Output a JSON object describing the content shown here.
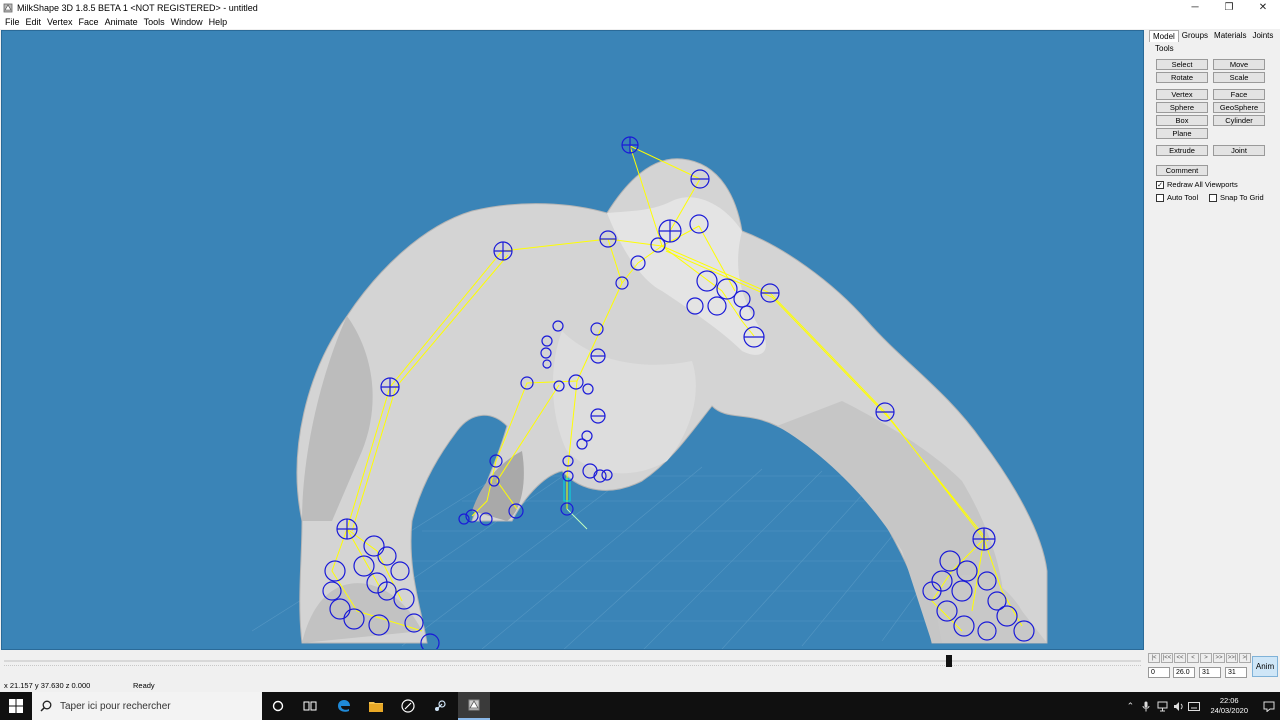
{
  "window": {
    "title": "MilkShape 3D 1.8.5 BETA 1 <NOT REGISTERED> - untitled",
    "controls": {
      "minimize": "─",
      "restore": "❐",
      "close": "✕"
    }
  },
  "menu": [
    "File",
    "Edit",
    "Vertex",
    "Face",
    "Animate",
    "Tools",
    "Window",
    "Help"
  ],
  "panel": {
    "tabs": [
      "Model",
      "Groups",
      "Materials",
      "Joints"
    ],
    "active_tab": "Model",
    "tools_label": "Tools",
    "buttons": {
      "select": "Select",
      "move": "Move",
      "rotate": "Rotate",
      "scale": "Scale",
      "vertex": "Vertex",
      "face": "Face",
      "sphere": "Sphere",
      "geosphere": "GeoSphere",
      "box": "Box",
      "cylinder": "Cylinder",
      "plane": "Plane",
      "extrude": "Extrude",
      "joint": "Joint",
      "comment": "Comment"
    },
    "checks": {
      "redraw_all": {
        "label": "Redraw All Viewports",
        "checked": true
      },
      "auto_tool": {
        "label": "Auto Tool",
        "checked": false
      },
      "snap_to_grid": {
        "label": "Snap To Grid",
        "checked": false
      }
    }
  },
  "timeline": {
    "frame_start": "0",
    "fps": "26.0",
    "current_frame": "31",
    "frame_end": "31",
    "anim_label": "Anim",
    "nav": [
      "|<",
      "|<<",
      "<<",
      "<",
      ">",
      ">>",
      ">>|",
      ">|"
    ]
  },
  "status": {
    "coords": "x 21.157 y 37.630 z 0.000",
    "message": "Ready"
  },
  "taskbar": {
    "search_placeholder": "Taper ici pour rechercher",
    "time": "22:06",
    "date": "24/03/2020"
  },
  "colors": {
    "viewport_bg": "#3a84b7",
    "bones": "#ffff00",
    "joints": "#1a1ad8",
    "mesh": "#d7d7d7"
  }
}
